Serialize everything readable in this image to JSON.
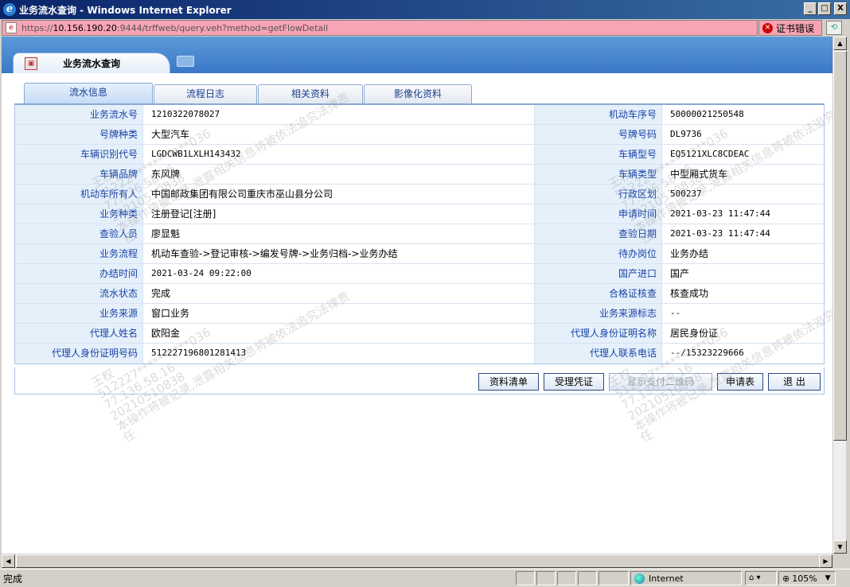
{
  "window": {
    "title": "业务流水查询 - Windows Internet Explorer",
    "min": "_",
    "max": "□",
    "close": "X"
  },
  "address": {
    "scheme": "https://",
    "host": "10.156.190.20",
    "rest": ":9444/trffweb/query.veh?method=getFlowDetail",
    "cert_error": "证书错误"
  },
  "page_tab": {
    "label": "业务流水查询"
  },
  "subtabs": [
    "流水信息",
    "流程日志",
    "相关资料",
    "影像化资料"
  ],
  "rows": [
    {
      "l1": "业务流水号",
      "v1": "1210322078027",
      "l2": "机动车序号",
      "v2": "50000021250548"
    },
    {
      "l1": "号牌种类",
      "v1": "大型汽车",
      "l2": "号牌号码",
      "v2": "DL9736"
    },
    {
      "l1": "车辆识别代号",
      "v1": "LGDCWB1LXLH143432",
      "l2": "车辆型号",
      "v2": "EQ5121XLC8CDEAC"
    },
    {
      "l1": "车辆品牌",
      "v1": "东风牌",
      "l2": "车辆类型",
      "v2": "中型厢式货车"
    },
    {
      "l1": "机动车所有人",
      "v1": "中国邮政集团有限公司重庆市巫山县分公司",
      "l2": "行政区划",
      "v2": "500237"
    },
    {
      "l1": "业务种类",
      "v1": "注册登记[注册]",
      "l2": "申请时间",
      "v2": "2021-03-23 11:47:44"
    },
    {
      "l1": "查验人员",
      "v1": "廖显魁",
      "l2": "查验日期",
      "v2": "2021-03-23 11:47:44"
    },
    {
      "l1": "业务流程",
      "v1": "机动车查验->登记审核->编发号牌->业务归档->业务办结",
      "l2": "待办岗位",
      "v2": "业务办结"
    },
    {
      "l1": "办结时间",
      "v1": "2021-03-24 09:22:00",
      "l2": "国产进口",
      "v2": "国产"
    },
    {
      "l1": "流水状态",
      "v1": "完成",
      "l2": "合格证核查",
      "v2": "核查成功"
    },
    {
      "l1": "业务来源",
      "v1": "窗口业务",
      "l2": "业务来源标志",
      "v2": "--"
    },
    {
      "l1": "代理人姓名",
      "v1": "欧阳金",
      "l2": "代理人身份证明名称",
      "v2": "居民身份证"
    },
    {
      "l1": "代理人身份证明号码",
      "v1": "512227196801281413",
      "l2": "代理人联系电话",
      "v2": "--/15323229666"
    }
  ],
  "buttons": {
    "materials": "资料清单",
    "receipt": "受理凭证",
    "qrcode": "显示支付二维码",
    "application": "申请表",
    "exit": "退 出"
  },
  "watermark": {
    "name": "王权",
    "id": "512227**********036",
    "ip": "77.136.58.16",
    "date": "20210510838",
    "warn1": "本操作将被记录,泄露相关信息将被依法追究法律责",
    "warn2": "任"
  },
  "status": {
    "text": "完成",
    "zone": "Internet",
    "zoom": "105%"
  },
  "colors": {
    "label_bg": "#e5f0fb",
    "label_text": "#1a43a6",
    "header_blue": "#3a78c8",
    "address_error": "#f7a4b4"
  }
}
